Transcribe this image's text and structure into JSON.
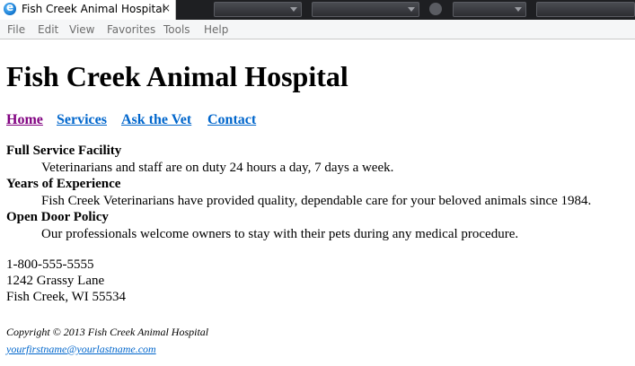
{
  "browser": {
    "tab_title": "Fish Creek Animal Hospital",
    "tab_close": "×",
    "menu": [
      "File",
      "Edit",
      "View",
      "Favorites",
      "Tools",
      "Help"
    ],
    "colors": {
      "tabstrip": "#1e1f22",
      "menubar": "#f5f6f7"
    }
  },
  "page": {
    "title": "Fish Creek Animal Hospital",
    "nav": [
      {
        "label": "Home",
        "state": "visited"
      },
      {
        "label": "Services",
        "state": "link"
      },
      {
        "label": "Ask the Vet",
        "state": "link"
      },
      {
        "label": "Contact",
        "state": "link"
      }
    ],
    "features": [
      {
        "term": "Full Service Facility",
        "desc": "Veterinarians and staff are on duty 24 hours a day, 7 days a week."
      },
      {
        "term": "Years of Experience",
        "desc": "Fish Creek Veterinarians have provided quality, dependable care for your beloved animals since 1984."
      },
      {
        "term": "Open Door Policy",
        "desc": "Our professionals welcome owners to stay with their pets during any medical procedure."
      }
    ],
    "contact": {
      "phone": "1-800-555-5555",
      "street": "1242 Grassy Lane",
      "city": "Fish Creek, WI 55534"
    },
    "footer": {
      "copyright": "Copyright © 2013 Fish Creek Animal Hospital",
      "email": "yourfirstname@yourlastname.com"
    },
    "colors": {
      "link": "#0066cc",
      "visited_link": "#800080"
    }
  }
}
